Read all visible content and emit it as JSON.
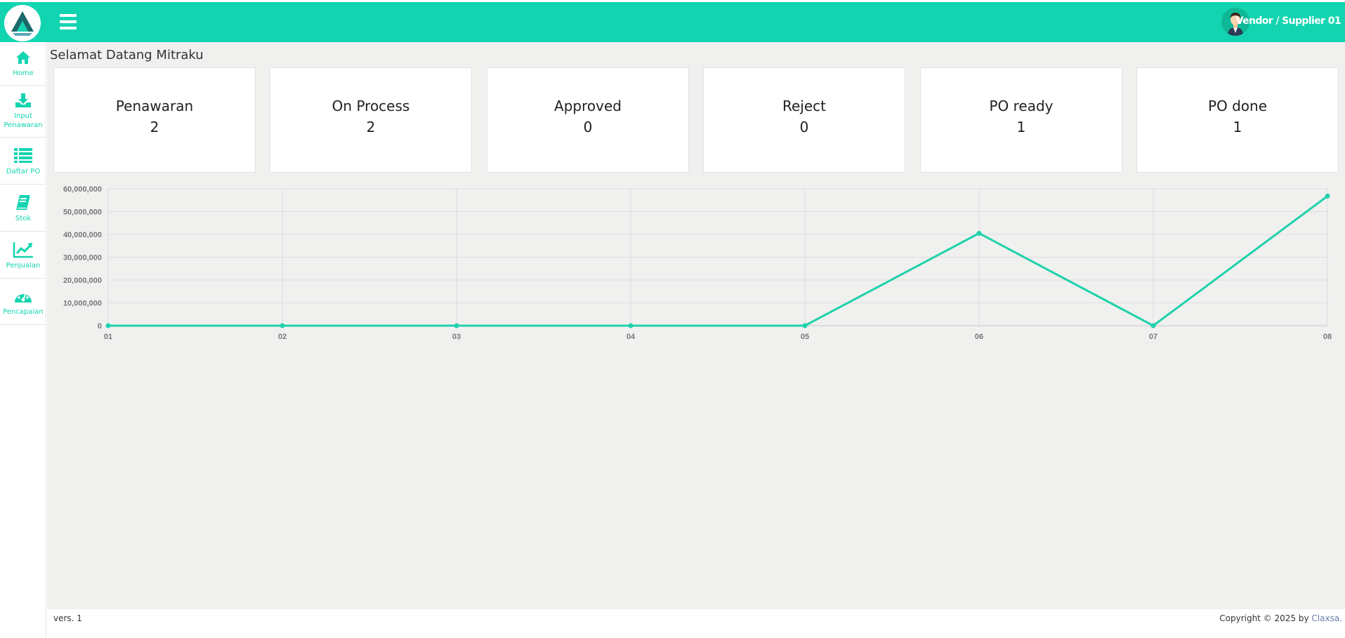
{
  "header": {
    "user_name": "Vendor / Supplier 01",
    "accent_color": "#13d4b0",
    "logo_icon": "company-logo",
    "menu_icon": "hamburger-menu-icon",
    "avatar_icon": "user-avatar"
  },
  "sidebar": {
    "items": [
      {
        "label": "Home",
        "icon": "home-icon"
      },
      {
        "label": "Input Penawaran",
        "icon": "download-tray-icon"
      },
      {
        "label": "Daftar PO",
        "icon": "list-icon"
      },
      {
        "label": "Stok",
        "icon": "book-icon"
      },
      {
        "label": "Penjualan",
        "icon": "line-chart-icon"
      },
      {
        "label": "Pencapaian",
        "icon": "gauge-icon"
      }
    ]
  },
  "main": {
    "welcome": "Selamat Datang Mitraku",
    "cards": [
      {
        "label": "Penawaran",
        "value": "2"
      },
      {
        "label": "On Process",
        "value": "2"
      },
      {
        "label": "Approved",
        "value": "0"
      },
      {
        "label": "Reject",
        "value": "0"
      },
      {
        "label": "PO ready",
        "value": "1"
      },
      {
        "label": "PO done",
        "value": "1"
      }
    ]
  },
  "chart_data": {
    "type": "line",
    "categories": [
      "01",
      "02",
      "03",
      "04",
      "05",
      "06",
      "07",
      "08"
    ],
    "series": [
      {
        "values": [
          0,
          0,
          0,
          0,
          0,
          40500000,
          0,
          56800000
        ],
        "color": "#1fd1ac"
      }
    ],
    "ylim": [
      0,
      60000000
    ],
    "yticks": [
      "0",
      "10,000,000",
      "20,000,000",
      "30,000,000",
      "40,000,000",
      "50,000,000",
      "60,000,000"
    ],
    "grid": true
  },
  "footer": {
    "version": "vers. 1",
    "copyright_prefix": "Copyright © 2025 by ",
    "brand": "Claxsa."
  }
}
